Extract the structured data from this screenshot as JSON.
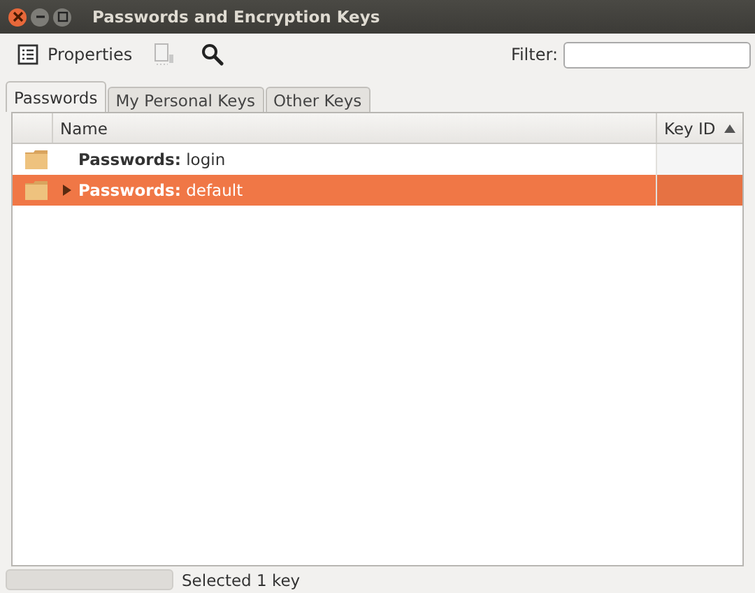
{
  "window": {
    "title": "Passwords and Encryption Keys"
  },
  "toolbar": [
    {
      "kind": "properties",
      "label": "Properties",
      "disabled": false
    },
    {
      "kind": "export",
      "disabled": true
    },
    {
      "kind": "search",
      "disabled": false
    }
  ],
  "filter": {
    "label": "Filter:"
  },
  "tabs": [
    {
      "label": "Passwords",
      "selected": true
    },
    {
      "label": "My Personal Keys",
      "selected": false
    },
    {
      "label": "Other Keys",
      "selected": false
    }
  ],
  "table": {
    "columns": [
      {
        "label": "Name",
        "sorted": false
      },
      {
        "label": "Key ID",
        "sorted": true
      }
    ],
    "rows": [
      {
        "name": "**Passwords:** login",
        "has_children": false,
        "selected": false
      },
      {
        "name": "**Passwords:** default",
        "has_children": true,
        "selected": true
      }
    ]
  },
  "status_bar": {
    "level": 0,
    "text": "Selected 1 key"
  }
}
